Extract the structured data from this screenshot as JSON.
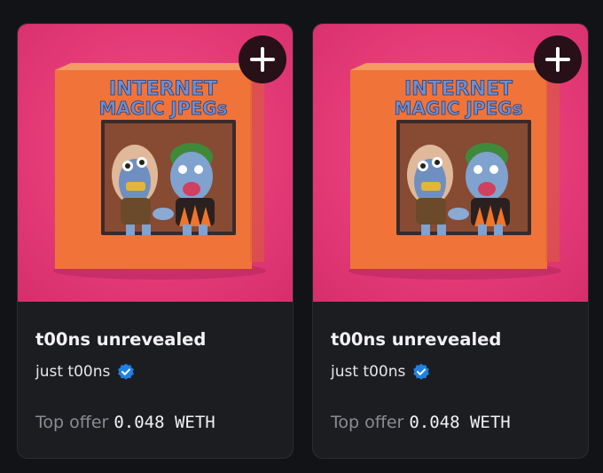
{
  "colors": {
    "background": "#121316",
    "card": "#1c1d21",
    "artwork_bg": "#e33a76",
    "box_orange": "#f0743a",
    "verified_blue": "#2081e2",
    "muted_text": "#8b8c93"
  },
  "cards": [
    {
      "title": "t00ns unrevealed",
      "collection": "just t00ns",
      "verified": true,
      "box_text_line1": "INTERNET",
      "box_text_line2": "MAGIC JPEGs",
      "offer_label": "Top offer",
      "offer_value": "0.048 WETH",
      "add_icon": "plus-icon"
    },
    {
      "title": "t00ns unrevealed",
      "collection": "just t00ns",
      "verified": true,
      "box_text_line1": "INTERNET",
      "box_text_line2": "MAGIC JPEGs",
      "offer_label": "Top offer",
      "offer_value": "0.048 WETH",
      "add_icon": "plus-icon"
    }
  ]
}
